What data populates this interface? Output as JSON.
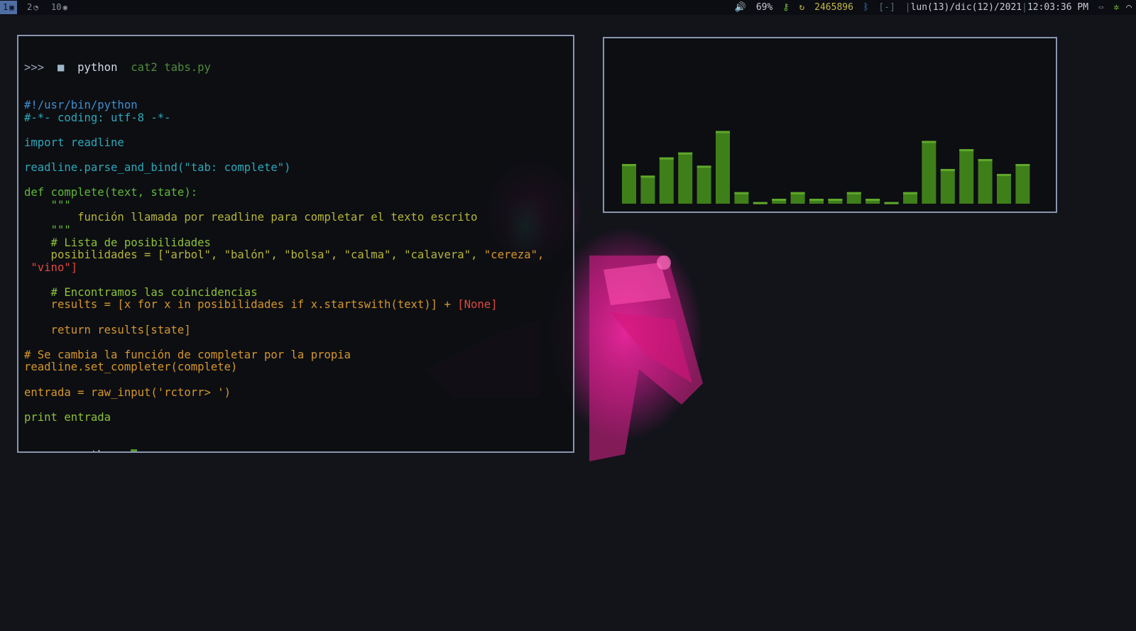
{
  "topbar": {
    "workspaces": [
      {
        "label": "1",
        "icon": "terminal-icon",
        "glyph": "▣",
        "active": true
      },
      {
        "label": "2",
        "icon": "browser-icon",
        "glyph": "◔",
        "active": false
      },
      {
        "label": "10",
        "icon": "compass-icon",
        "glyph": "◉",
        "active": false
      }
    ],
    "status": {
      "volume": "69%",
      "volume_icon": "speaker-icon",
      "key_icon": "key-icon",
      "update_icon": "refresh-icon",
      "update_count": "2465896",
      "bluetooth_icon": "bluetooth-icon",
      "bt_state": "[-]",
      "date": "lun(13)/dic(12)/2021",
      "time": "12:03:36 PM",
      "net_icon": "network-icon",
      "tray_icons": [
        "settings-icon",
        "wifi-icon"
      ]
    }
  },
  "terminal": {
    "prompt_symbol": ">>>",
    "prompt_dir": "python",
    "command": "cat2 tabs.py",
    "folder_icon": "folder-icon",
    "lines": [
      [
        [
          "#!/usr/bin/python",
          "c-blue"
        ]
      ],
      [
        [
          "#-*- coding: utf-8 -*-",
          "c-teal"
        ]
      ],
      [],
      [
        [
          "import readline",
          "c-teal"
        ]
      ],
      [],
      [
        [
          "readline.parse_and_bind(\"tab: complete\")",
          "c-teal"
        ]
      ],
      [],
      [
        [
          "def complete(text, state):",
          "c-green"
        ]
      ],
      [
        [
          "    \"\"\"",
          "c-green"
        ]
      ],
      [
        [
          "        función llamada por readline para completar el texto escrito",
          "c-yel"
        ]
      ],
      [
        [
          "    \"\"\"",
          "c-green"
        ]
      ],
      [
        [
          "    # Lista de posibilidades",
          "c-lime"
        ]
      ],
      [
        [
          "    posibilidades = [\"arbol\", \"balón\", \"bolsa\", \"calma\", \"calavera\", ",
          "c-yel"
        ],
        [
          "\"cereza\",",
          "c-org"
        ]
      ],
      [
        [
          " \"vino\"]",
          "c-red"
        ]
      ],
      [],
      [
        [
          "    # Encontramos las coincidencias",
          "c-lime"
        ]
      ],
      [
        [
          "    results = [x for x in posibilidades if x.startswith(text)] + ",
          "c-org"
        ],
        [
          "[None]",
          "c-red"
        ]
      ],
      [],
      [
        [
          "    return results[state]",
          "c-org"
        ]
      ],
      [],
      [
        [
          "# Se cambia la función de completar por la propia",
          "c-org"
        ]
      ],
      [
        [
          "readline.set_completer(complete)",
          "c-org"
        ]
      ],
      [],
      [
        [
          "entrada = raw_input('rctorr> ')",
          "c-org"
        ]
      ],
      [],
      [
        [
          "print entrada",
          "c-lime"
        ]
      ]
    ]
  },
  "visualizer": {
    "levels": [
      0.24,
      0.17,
      0.28,
      0.31,
      0.23,
      0.44,
      0.07,
      0.01,
      0.03,
      0.07,
      0.03,
      0.03,
      0.07,
      0.03,
      0.01,
      0.07,
      0.38,
      0.21,
      0.33,
      0.27,
      0.18,
      0.24
    ],
    "bar_color": "#3f7f1a",
    "bar_top_color": "#5fa82a"
  }
}
